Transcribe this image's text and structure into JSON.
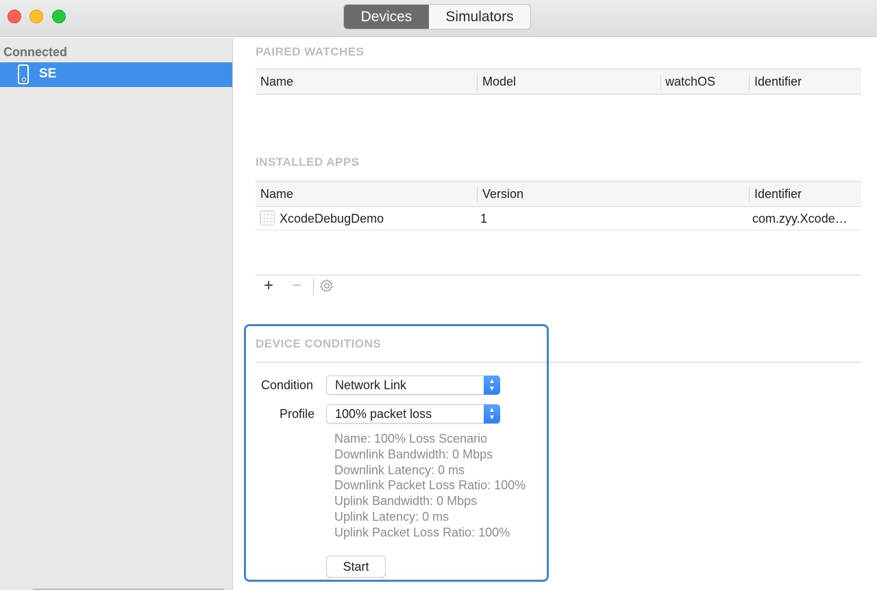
{
  "window": {
    "tabs": [
      {
        "label": "Devices",
        "active": true
      },
      {
        "label": "Simulators",
        "active": false
      }
    ]
  },
  "sidebar": {
    "section": "Connected",
    "devices": [
      {
        "label": "SE",
        "icon": "iphone-icon",
        "selected": true
      }
    ]
  },
  "paired_watches": {
    "title": "PAIRED WATCHES",
    "columns": [
      "Name",
      "Model",
      "watchOS",
      "Identifier"
    ],
    "rows": []
  },
  "installed_apps": {
    "title": "INSTALLED APPS",
    "columns": [
      "Name",
      "Version",
      "Identifier"
    ],
    "rows": [
      {
        "name": "XcodeDebugDemo",
        "version": "1",
        "identifier": "com.zyy.Xcode…"
      }
    ]
  },
  "toolbar": {
    "add_label": "+",
    "remove_label": "−"
  },
  "device_conditions": {
    "title": "DEVICE CONDITIONS",
    "condition_label": "Condition",
    "condition_value": "Network Link",
    "profile_label": "Profile",
    "profile_value": "100% packet loss",
    "details": [
      "Name: 100% Loss Scenario",
      "Downlink Bandwidth: 0 Mbps",
      "Downlink Latency: 0 ms",
      "Downlink Packet Loss Ratio: 100%",
      "Uplink Bandwidth: 0 Mbps",
      "Uplink Latency: 0 ms",
      "Uplink Packet Loss Ratio: 100%"
    ],
    "start_label": "Start"
  },
  "colors": {
    "selection": "#3f8fed",
    "highlight_border": "#3f87cf",
    "segment_active": "#6b6b6b"
  }
}
